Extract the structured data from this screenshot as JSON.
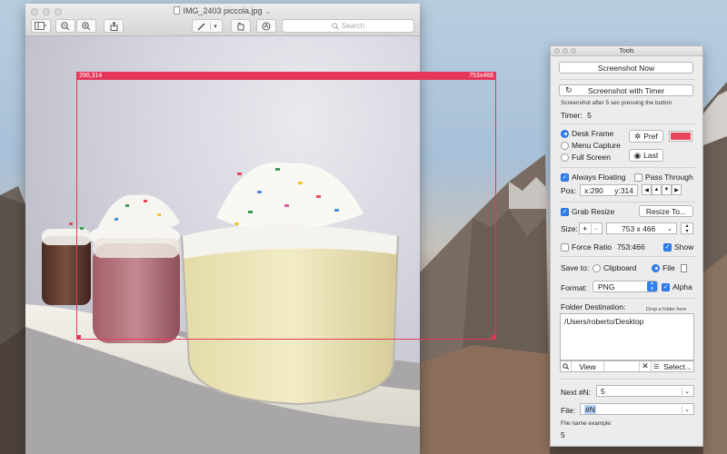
{
  "preview": {
    "title": "IMG_2403 piccola.jpg",
    "title_chevron": "⌄",
    "search_placeholder": "Search",
    "toolbar": [
      {
        "name": "sidebar-toggle-button",
        "icon": "sidebar-icon"
      },
      {
        "name": "zoom-out-button",
        "icon": "zoom-out-icon"
      },
      {
        "name": "zoom-in-button",
        "icon": "zoom-in-icon"
      },
      {
        "name": "share-button",
        "icon": "share-icon"
      },
      {
        "name": "markup-pen-button",
        "icon": "pen-icon"
      },
      {
        "name": "rotate-button",
        "icon": "rotate-icon"
      },
      {
        "name": "markup-toolbox-button",
        "icon": "markup-icon"
      }
    ]
  },
  "capture": {
    "position_label": "290,314",
    "size_label": "753x466",
    "color": "#e6365a"
  },
  "tools": {
    "title": "Tools",
    "screenshot_now": "Screenshot Now",
    "screenshot_timer": "Screenshot with Timer",
    "timer_note": "Screenshot after 5 sec pressing the button",
    "timer_label": "Timer:",
    "timer_value": "5",
    "modes": [
      {
        "label": "Desk Frame",
        "selected": true
      },
      {
        "label": "Menu Capture",
        "selected": false
      },
      {
        "label": "Full Screen",
        "selected": false
      }
    ],
    "pref_label": "Pref",
    "last_label": "Last",
    "frame_color": "#e8465e",
    "always_floating": {
      "label": "Always Floating",
      "checked": true
    },
    "pass_through": {
      "label": "Pass Through",
      "checked": false
    },
    "pos_label": "Pos:",
    "pos_x": "x:290",
    "pos_y": "y:314",
    "arrows": [
      "◀",
      "▲",
      "▼",
      "▶"
    ],
    "grab_resize": {
      "label": "Grab Resize",
      "checked": true
    },
    "resize_to": "Resize To...",
    "size_label": "Size:",
    "size_value": "753 x 466",
    "force_ratio": {
      "label": "Force Ratio",
      "checked": false
    },
    "ratio_value": "753:466",
    "show": {
      "label": "Show",
      "checked": true
    },
    "save_to_label": "Save to:",
    "save_clipboard": {
      "label": "Clipboard",
      "selected": false
    },
    "save_file": {
      "label": "File",
      "selected": true
    },
    "format_label": "Format:",
    "format_value": "PNG",
    "alpha": {
      "label": "Alpha",
      "checked": true
    },
    "folder_label": "Folder Destination:",
    "drop_hint": "Drop a folder here",
    "folder_path": "/Users/roberto/Desktop",
    "view_label": "View",
    "select_label": "Select...",
    "next_label": "Next #N:",
    "next_value": "5",
    "file_label": "File:",
    "file_value": "#N",
    "example_label": "File name example:",
    "example_value": "5"
  }
}
